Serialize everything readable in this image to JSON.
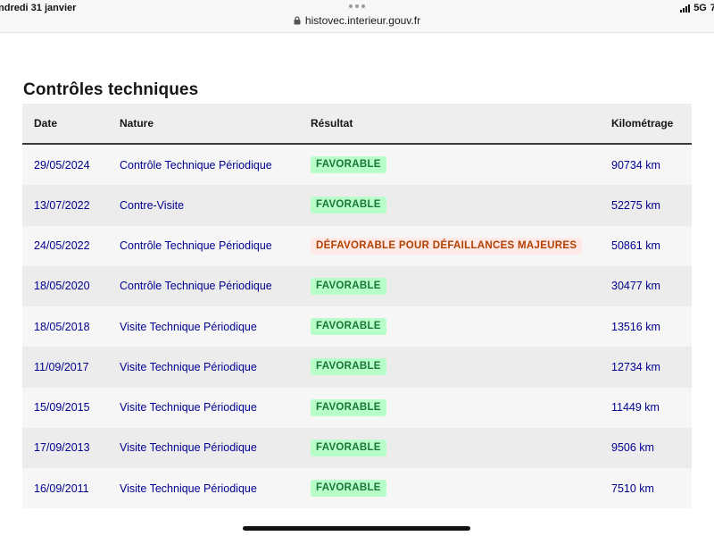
{
  "status_bar": {
    "date": "ndredi 31 janvier",
    "url": "histovec.interieur.gouv.fr",
    "network": "5G",
    "battery_partial": "7"
  },
  "page": {
    "title": "Contrôles techniques"
  },
  "table": {
    "headers": {
      "date": "Date",
      "nature": "Nature",
      "result": "Résultat",
      "km": "Kilométrage"
    },
    "rows": [
      {
        "date": "29/05/2024",
        "nature": "Contrôle Technique Périodique",
        "result": "FAVORABLE",
        "status": "fav",
        "km": "90734 km"
      },
      {
        "date": "13/07/2022",
        "nature": "Contre-Visite",
        "result": "FAVORABLE",
        "status": "fav",
        "km": "52275 km"
      },
      {
        "date": "24/05/2022",
        "nature": "Contrôle Technique Périodique",
        "result": "DÉFAVORABLE POUR DÉFAILLANCES MAJEURES",
        "status": "defav",
        "km": "50861 km"
      },
      {
        "date": "18/05/2020",
        "nature": "Contrôle Technique Périodique",
        "result": "FAVORABLE",
        "status": "fav",
        "km": "30477 km"
      },
      {
        "date": "18/05/2018",
        "nature": "Visite Technique Périodique",
        "result": "FAVORABLE",
        "status": "fav",
        "km": "13516 km"
      },
      {
        "date": "11/09/2017",
        "nature": "Visite Technique Périodique",
        "result": "FAVORABLE",
        "status": "fav",
        "km": "12734 km"
      },
      {
        "date": "15/09/2015",
        "nature": "Visite Technique Périodique",
        "result": "FAVORABLE",
        "status": "fav",
        "km": "11449 km"
      },
      {
        "date": "17/09/2013",
        "nature": "Visite Technique Périodique",
        "result": "FAVORABLE",
        "status": "fav",
        "km": "9506 km"
      },
      {
        "date": "16/09/2011",
        "nature": "Visite Technique Périodique",
        "result": "FAVORABLE",
        "status": "fav",
        "km": "7510 km"
      }
    ]
  },
  "icons": {
    "lock": "lock-icon",
    "signal": "signal-icon",
    "dots": "more-dots-icon"
  },
  "colors": {
    "link_blue": "#000091",
    "favorable_bg": "#b8fec9",
    "favorable_text": "#18753c",
    "defavorable_bg": "#ffe9e6",
    "defavorable_text": "#b34000"
  }
}
